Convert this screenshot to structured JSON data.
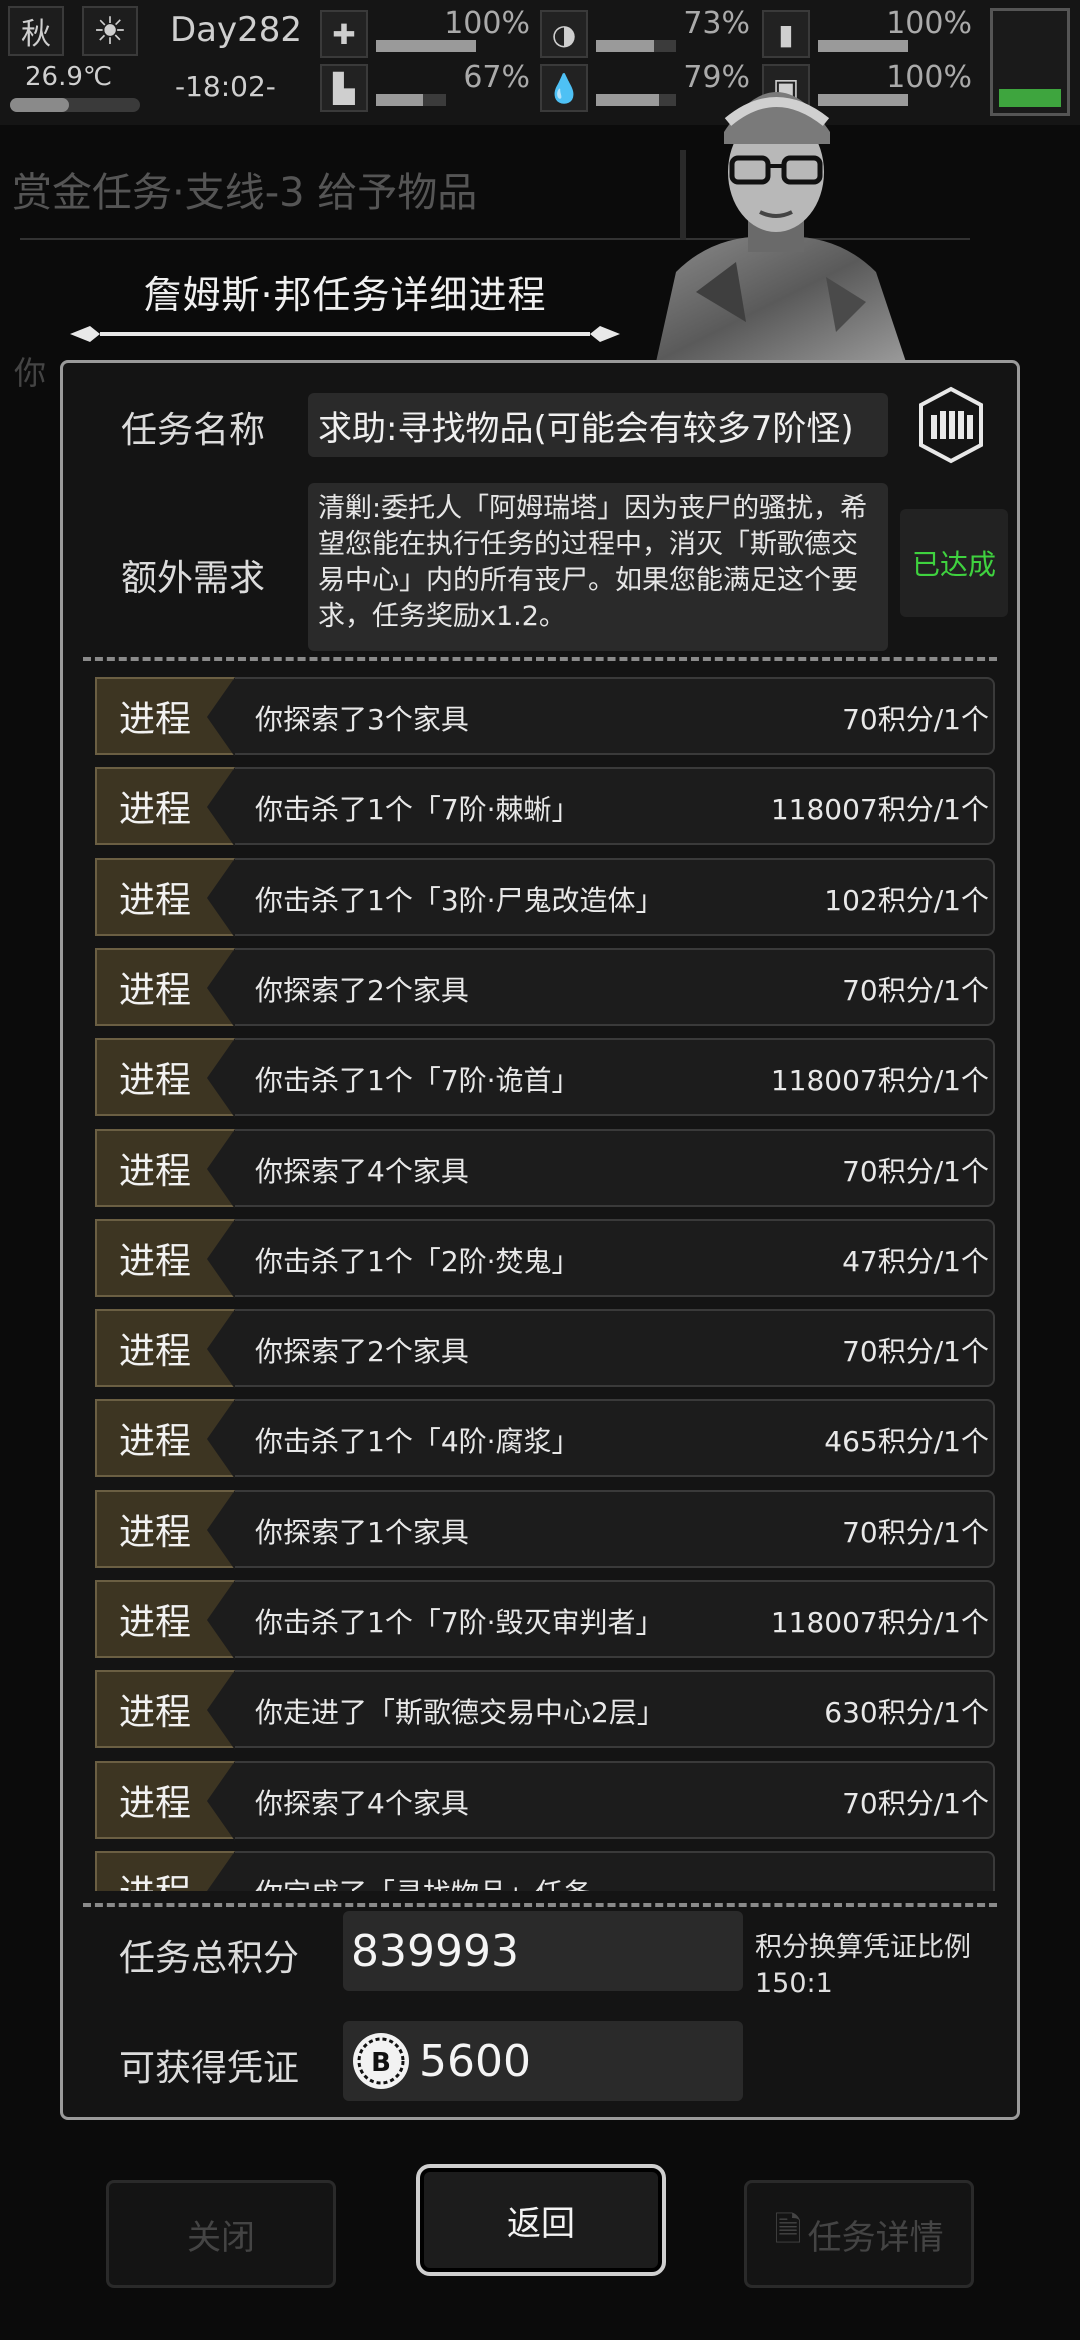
{
  "status": {
    "season": "秋",
    "temperature": "26.9℃",
    "day": "Day282",
    "clock": "-18:02-",
    "stats": [
      {
        "icon": "medkit-icon",
        "value": "100%",
        "fill": 1.0
      },
      {
        "icon": "stomach-icon",
        "value": "73%",
        "fill": 0.73
      },
      {
        "icon": "battery-small-icon",
        "value": "100%",
        "fill": 1.0
      },
      {
        "icon": "boot-icon",
        "value": "67%",
        "fill": 0.67
      },
      {
        "icon": "water-drop-icon",
        "value": "79%",
        "fill": 0.79
      },
      {
        "icon": "vest-icon",
        "value": "100%",
        "fill": 1.0
      }
    ]
  },
  "background": {
    "title": "赏金任务·支线-3 给予物品",
    "subtitle": "你",
    "close_label": "关闭",
    "details_label": "任务详情"
  },
  "dialog": {
    "title": "詹姆斯·邦任务详细进程",
    "task_name_label": "任务名称",
    "task_name": "求助:寻找物品(可能会有较多7阶怪)",
    "extra_req_label": "额外需求",
    "extra_req_text": "清剿:委托人「阿姆瑞塔」因为丧尸的骚扰，希望您能在执行任务的过程中，消灭「斯歌德交易中心」内的所有丧尸。如果您能满足这个要求，任务奖励x1.2。",
    "achieved_label": "已达成",
    "progress_tag": "进程",
    "rows": [
      {
        "desc": "你探索了3个家具",
        "pts": "70积分/1个"
      },
      {
        "desc": "你击杀了1个「7阶·棘蜥」",
        "pts": "118007积分/1个"
      },
      {
        "desc": "你击杀了1个「3阶·尸鬼改造体」",
        "pts": "102积分/1个"
      },
      {
        "desc": "你探索了2个家具",
        "pts": "70积分/1个"
      },
      {
        "desc": "你击杀了1个「7阶·诡首」",
        "pts": "118007积分/1个"
      },
      {
        "desc": "你探索了4个家具",
        "pts": "70积分/1个"
      },
      {
        "desc": "你击杀了1个「2阶·焚鬼」",
        "pts": "47积分/1个"
      },
      {
        "desc": "你探索了2个家具",
        "pts": "70积分/1个"
      },
      {
        "desc": "你击杀了1个「4阶·腐浆」",
        "pts": "465积分/1个"
      },
      {
        "desc": "你探索了1个家具",
        "pts": "70积分/1个"
      },
      {
        "desc": "你击杀了1个「7阶·毁灭审判者」",
        "pts": "118007积分/1个"
      },
      {
        "desc": "你走进了「斯歌德交易中心2层」",
        "pts": "630积分/1个"
      },
      {
        "desc": "你探索了4个家具",
        "pts": "70积分/1个"
      },
      {
        "desc": "你完成了「寻找物品」任务",
        "pts": ""
      }
    ],
    "total_label": "任务总积分",
    "total_value": "839993",
    "ratio_label": "积分换算凭证比例",
    "ratio_value": "150:1",
    "voucher_label": "可获得凭证",
    "voucher_value": "5600",
    "return_label": "返回"
  }
}
